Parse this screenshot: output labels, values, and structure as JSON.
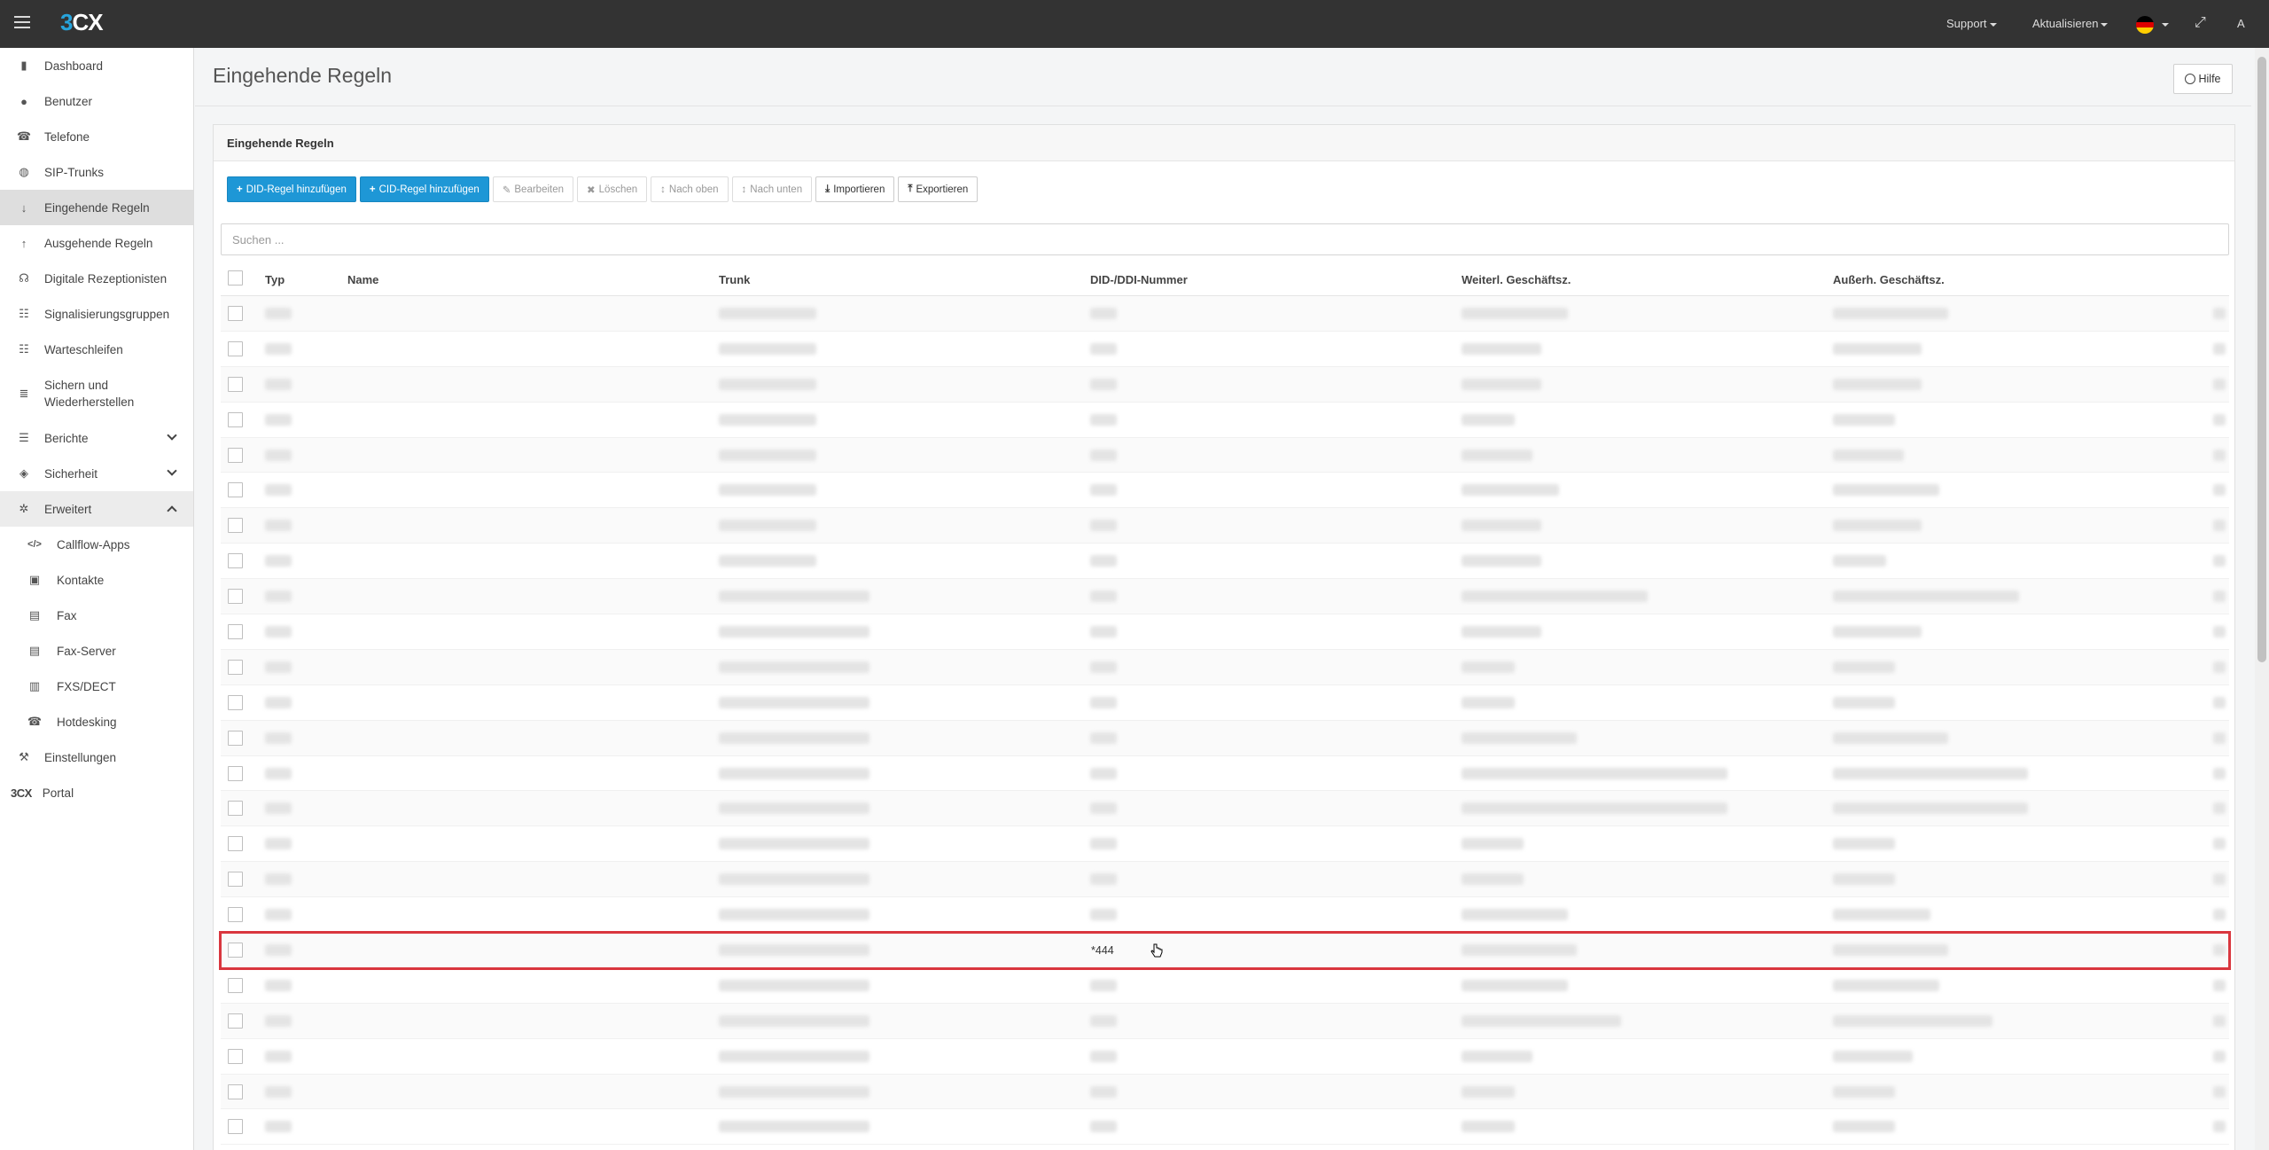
{
  "app": {
    "logo_number": "3",
    "logo_text": "CX",
    "support_label": "Support",
    "update_label": "Aktualisieren",
    "user_label": "A",
    "language_flag": "german-flag"
  },
  "sidebar": {
    "items": [
      {
        "label": "Dashboard",
        "icon": "bar-chart-icon",
        "glyph": "▮"
      },
      {
        "label": "Benutzer",
        "icon": "user-icon",
        "glyph": "●"
      },
      {
        "label": "Telefone",
        "icon": "phone-icon",
        "glyph": "☎"
      },
      {
        "label": "SIP-Trunks",
        "icon": "globe-icon",
        "glyph": "◍"
      },
      {
        "label": "Eingehende Regeln",
        "icon": "arrow-down-icon",
        "glyph": "↓"
      },
      {
        "label": "Ausgehende Regeln",
        "icon": "arrow-up-icon",
        "glyph": "↑"
      },
      {
        "label": "Digitale Rezeptionisten",
        "icon": "headset-icon",
        "glyph": "☊"
      },
      {
        "label": "Signalisierungsgruppen",
        "icon": "group-icon",
        "glyph": "☷"
      },
      {
        "label": "Warteschleifen",
        "icon": "users-icon",
        "glyph": "☷"
      },
      {
        "label": "Sichern und Wiederherstellen",
        "icon": "database-icon",
        "glyph": "≣"
      },
      {
        "label": "Berichte",
        "icon": "list-icon",
        "glyph": "☰"
      },
      {
        "label": "Sicherheit",
        "icon": "shield-icon",
        "glyph": "◈"
      },
      {
        "label": "Erweitert",
        "icon": "gear-icon",
        "glyph": "✲"
      },
      {
        "label": "Callflow-Apps",
        "icon": "code-icon",
        "glyph": "</>"
      },
      {
        "label": "Kontakte",
        "icon": "address-book-icon",
        "glyph": "▣"
      },
      {
        "label": "Fax",
        "icon": "fax-icon",
        "glyph": "▤"
      },
      {
        "label": "Fax-Server",
        "icon": "fax-server-icon",
        "glyph": "▤"
      },
      {
        "label": "FXS/DECT",
        "icon": "fxs-icon",
        "glyph": "▥"
      },
      {
        "label": "Hotdesking",
        "icon": "hotdesk-phone-icon",
        "glyph": "☎"
      },
      {
        "label": "Einstellungen",
        "icon": "wrench-icon",
        "glyph": "⚒"
      },
      {
        "label": "Portal",
        "icon": "3cx-portal-icon",
        "glyph": "3CX"
      }
    ]
  },
  "page": {
    "title": "Eingehende Regeln",
    "help_label": "Hilfe",
    "panel_title": "Eingehende Regeln"
  },
  "toolbar": {
    "add_did": "DID-Regel hinzufügen",
    "add_cid": "CID-Regel hinzufügen",
    "edit": "Bearbeiten",
    "delete": "Löschen",
    "move_up": "Nach oben",
    "move_down": "Nach unten",
    "import": "Importieren",
    "export": "Exportieren"
  },
  "search": {
    "placeholder": "Suchen ..."
  },
  "table": {
    "headers": {
      "type": "Typ",
      "name": "Name",
      "trunk": "Trunk",
      "did": "DID-/DDI-Nummer",
      "office": "Weiterl. Geschäftsz.",
      "outside": "Außerh. Geschäftsz."
    },
    "highlighted_row_did": "*444"
  },
  "colors": {
    "primary": "#1e97d6",
    "topbar": "#333333",
    "highlight": "#d9363e"
  }
}
